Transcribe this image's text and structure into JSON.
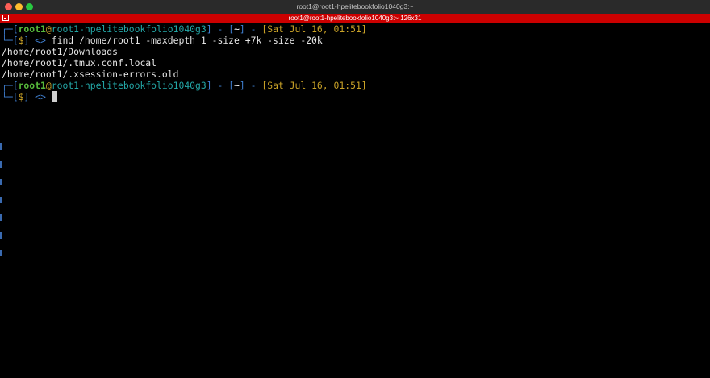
{
  "window": {
    "title": "root1@root1-hpelitebookfolio1040g3:~"
  },
  "tab": {
    "title": "root1@root1-hpelitebookfolio1040g3:~ 126x31"
  },
  "terminal": {
    "prompt1": {
      "corner_top": "┌─[",
      "user": "root1",
      "at": "@",
      "host": "root1-hpelitebookfolio1040g3",
      "close1": "]",
      "sep1": " - ",
      "open2": "[",
      "dir": "~",
      "close2": "]",
      "sep2": " - ",
      "date": "[Sat Jul 16, 01:51]",
      "corner_bottom": "└─[",
      "symbol": "$",
      "close3": "]",
      "arrow": " <> ",
      "command": "find /home/root1 -maxdepth 1 -size +7k -size -20k"
    },
    "output": [
      "/home/root1/Downloads",
      "/home/root1/.tmux.conf.local",
      "/home/root1/.xsession-errors.old"
    ],
    "prompt2": {
      "corner_top": "┌─[",
      "user": "root1",
      "at": "@",
      "host": "root1-hpelitebookfolio1040g3",
      "close1": "]",
      "sep1": " - ",
      "open2": "[",
      "dir": "~",
      "close2": "]",
      "sep2": " - ",
      "date": "[Sat Jul 16, 01:51]",
      "corner_bottom": "└─[",
      "symbol": "$",
      "close3": "]",
      "arrow": " <> "
    }
  },
  "colors": {
    "prompt_frame": "#3f7fd0",
    "user": "#56b83a",
    "host": "#23a6a6",
    "date": "#c9a227",
    "tab_bar": "#cc0000",
    "background": "#000000"
  }
}
